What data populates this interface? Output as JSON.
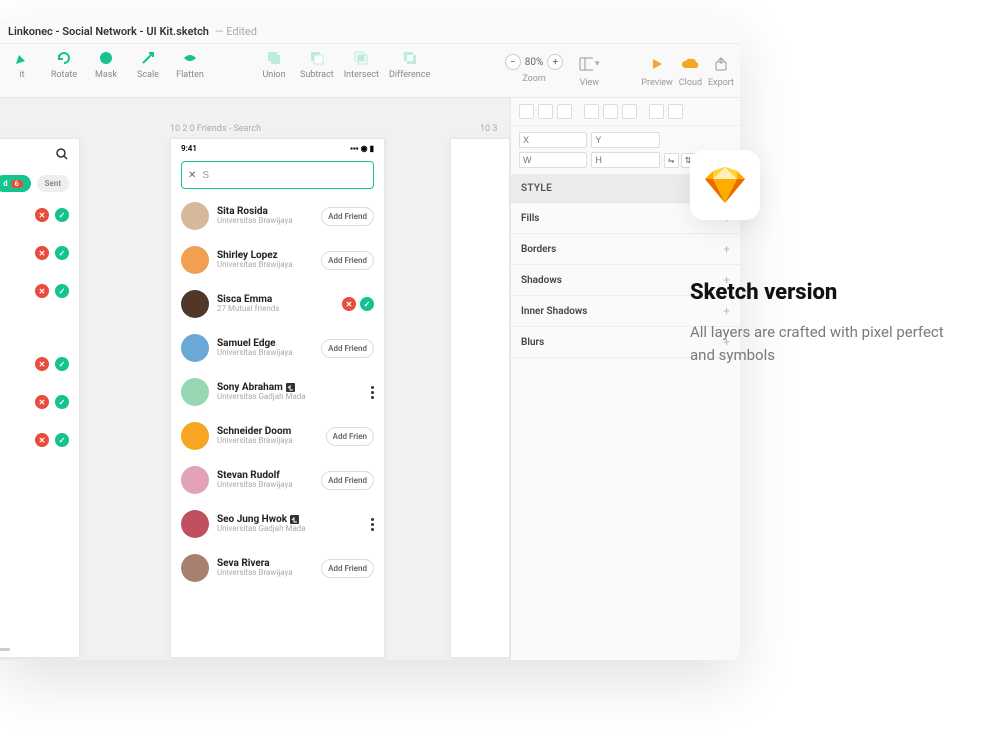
{
  "window": {
    "filename": "Linkonec - Social Network - UI Kit.sketch",
    "edited_suffix": "—  Edited"
  },
  "toolbar": {
    "items_left": [
      "it",
      "Rotate",
      "Mask",
      "Scale",
      "Flatten"
    ],
    "items_bool": [
      "Union",
      "Subtract",
      "Intersect",
      "Difference"
    ],
    "zoom_label": "Zoom",
    "zoom_value": "80%",
    "view_label": "View",
    "preview_label": "Preview",
    "cloud_label": "Cloud",
    "export_label": "Export"
  },
  "inspector": {
    "pos_fields": [
      "X",
      "Y"
    ],
    "size_fields": [
      "W",
      "H"
    ],
    "style_header": "STYLE",
    "sections": [
      "Fills",
      "Borders",
      "Shadows",
      "Inner Shadows",
      "Blurs"
    ]
  },
  "canvas": {
    "artboard_mid_label": "10 2 0 Friends - Search",
    "artboard_right_label": "10 3",
    "phone_time": "9:41",
    "search_value": "S",
    "received_pill": "d",
    "received_badge": "6",
    "sent_pill": "Sent",
    "add_friend_label": "Add Friend",
    "add_friend_short": "Add Frien",
    "friends": [
      {
        "name": "Sita Rosida",
        "sub": "Universitas Brawijaya",
        "action": "add",
        "avatar": "#d8b89a"
      },
      {
        "name": "Shirley Lopez",
        "sub": "Universitas Brawijaya",
        "action": "add",
        "avatar": "#f0a050"
      },
      {
        "name": "Sisca Emma",
        "sub": "27 Mutual friends",
        "action": "confirm",
        "avatar": "#503828"
      },
      {
        "name": "Samuel Edge",
        "sub": "Universitas Brawijaya",
        "action": "add",
        "avatar": "#6aa8d8"
      },
      {
        "name": "Sony Abraham",
        "sub": "Universitas Gadjah Mada",
        "action": "more",
        "badge": true,
        "avatar": "#96d6b0"
      },
      {
        "name": "Schneider Doom",
        "sub": "Universitas Brawijaya",
        "action": "add_short",
        "avatar": "#f6a623"
      },
      {
        "name": "Stevan Rudolf",
        "sub": "Universitas Brawijaya",
        "action": "add",
        "avatar": "#e2a2b8"
      },
      {
        "name": "Seo Jung Hwok",
        "sub": "Universitas Gadjah Mada",
        "action": "more",
        "badge": true,
        "avatar": "#c05060"
      },
      {
        "name": "Seva Rivera",
        "sub": "Universitas Brawijaya",
        "action": "add",
        "avatar": "#a88070"
      }
    ]
  },
  "promo": {
    "title": "Sketch version",
    "body": "All layers are crafted with pixel perfect and symbols"
  }
}
